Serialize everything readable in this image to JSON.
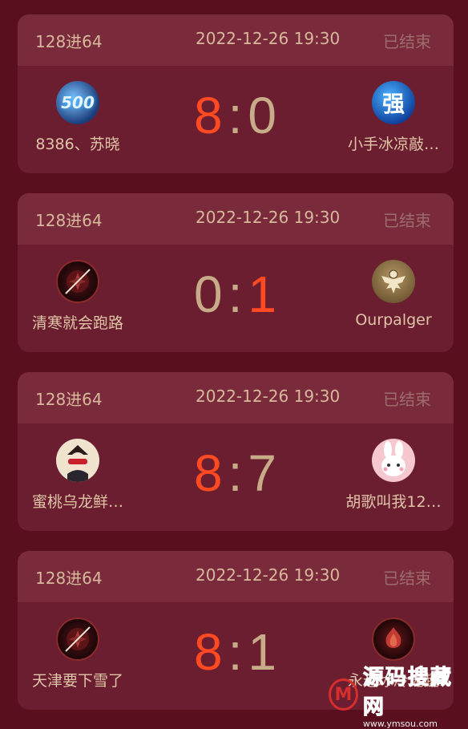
{
  "matches": [
    {
      "round": "128进64",
      "time": "2022-12-26 19:30",
      "status": "已结束",
      "left": {
        "name": "8386、苏晓",
        "avatar_icon": "500-badge-avatar"
      },
      "right": {
        "name": "小手冰凉敲…",
        "avatar_icon": "qiang-avatar"
      },
      "score_left": "8",
      "score_right": "0",
      "colon": ":"
    },
    {
      "round": "128进64",
      "time": "2022-12-26 19:30",
      "status": "已结束",
      "left": {
        "name": "清寒就会跑路",
        "avatar_icon": "blade-avatar"
      },
      "right": {
        "name": "Ourpalger",
        "avatar_icon": "eagle-avatar"
      },
      "score_left": "0",
      "score_right": "1",
      "colon": ":"
    },
    {
      "round": "128进64",
      "time": "2022-12-26 19:30",
      "status": "已结束",
      "left": {
        "name": "蜜桃乌龙鲜…",
        "avatar_icon": "masked-character-avatar"
      },
      "right": {
        "name": "胡歌叫我12…",
        "avatar_icon": "bunny-avatar"
      },
      "score_left": "8",
      "score_right": "7",
      "colon": ":"
    },
    {
      "round": "128进64",
      "time": "2022-12-26 19:30",
      "status": "已结束",
      "left": {
        "name": "天津要下雪了",
        "avatar_icon": "blade-avatar"
      },
      "right": {
        "name": "永远冰冷无趣",
        "avatar_icon": "flame-avatar"
      },
      "score_left": "8",
      "score_right": "1",
      "colon": ":"
    }
  ],
  "watermark": {
    "logo": "M",
    "text": "源码搜藏网",
    "url": "www.ymsou.com"
  },
  "colors": {
    "background": "#5a0f1f",
    "card": "#6b1e2f",
    "card_header": "#7a2b3b",
    "winner_score": "#ff4a22",
    "loser_score": "#c8ac8a"
  }
}
